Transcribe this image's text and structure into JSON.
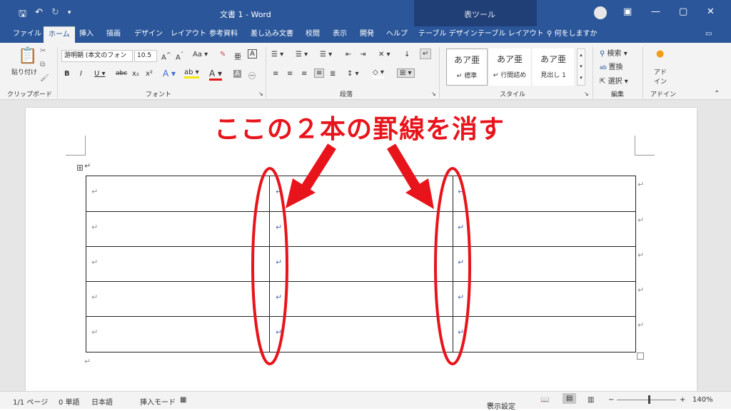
{
  "titlebar": {
    "doc_title": "文書 1  -  Word",
    "context_tab_group": "表ツール",
    "qat_icons": [
      "save-icon",
      "undo-icon",
      "redo-icon",
      "customize-qat-icon"
    ],
    "window_controls": [
      "ribbon-display-icon",
      "minimize-icon",
      "maximize-icon",
      "close-icon"
    ],
    "accent": "#2b579a"
  },
  "tabs": [
    "ファイル",
    "ホーム",
    "挿入",
    "描画",
    "デザイン",
    "レイアウト",
    "参考資料",
    "差し込み文書",
    "校閲",
    "表示",
    "開発",
    "ヘルプ",
    "テーブル デザイン",
    "テーブル レイアウト"
  ],
  "tell_me": "何をしますか",
  "ribbon": {
    "clipboard": {
      "paste": "貼り付け",
      "label": "クリップボード"
    },
    "font": {
      "font_name": "游明朝 (本文のフォン",
      "font_size": "10.5",
      "label": "フォント"
    },
    "paragraph": {
      "label": "段落"
    },
    "styles": {
      "items": [
        {
          "sample": "あア亜",
          "name": "↵ 標準"
        },
        {
          "sample": "あア亜",
          "name": "↵ 行間詰め"
        },
        {
          "sample": "あア亜",
          "name": "見出し 1"
        }
      ],
      "label": "スタイル"
    },
    "editing": {
      "find": "検索",
      "replace": "置換",
      "select": "選択",
      "label": "編集"
    },
    "addin": {
      "name": "アド\nイン",
      "label": "アドイン"
    }
  },
  "annotation": {
    "text": "ここの２本の罫線を消す",
    "color": "#e8141b"
  },
  "table": {
    "rows": 5,
    "cols": 3,
    "cell_mark": "↵"
  },
  "statusbar": {
    "page": "1/1 ページ",
    "words": "0 単語",
    "lang": "日本語",
    "mode": "挿入モード",
    "display_settings": "表示設定",
    "zoom": "140%"
  }
}
